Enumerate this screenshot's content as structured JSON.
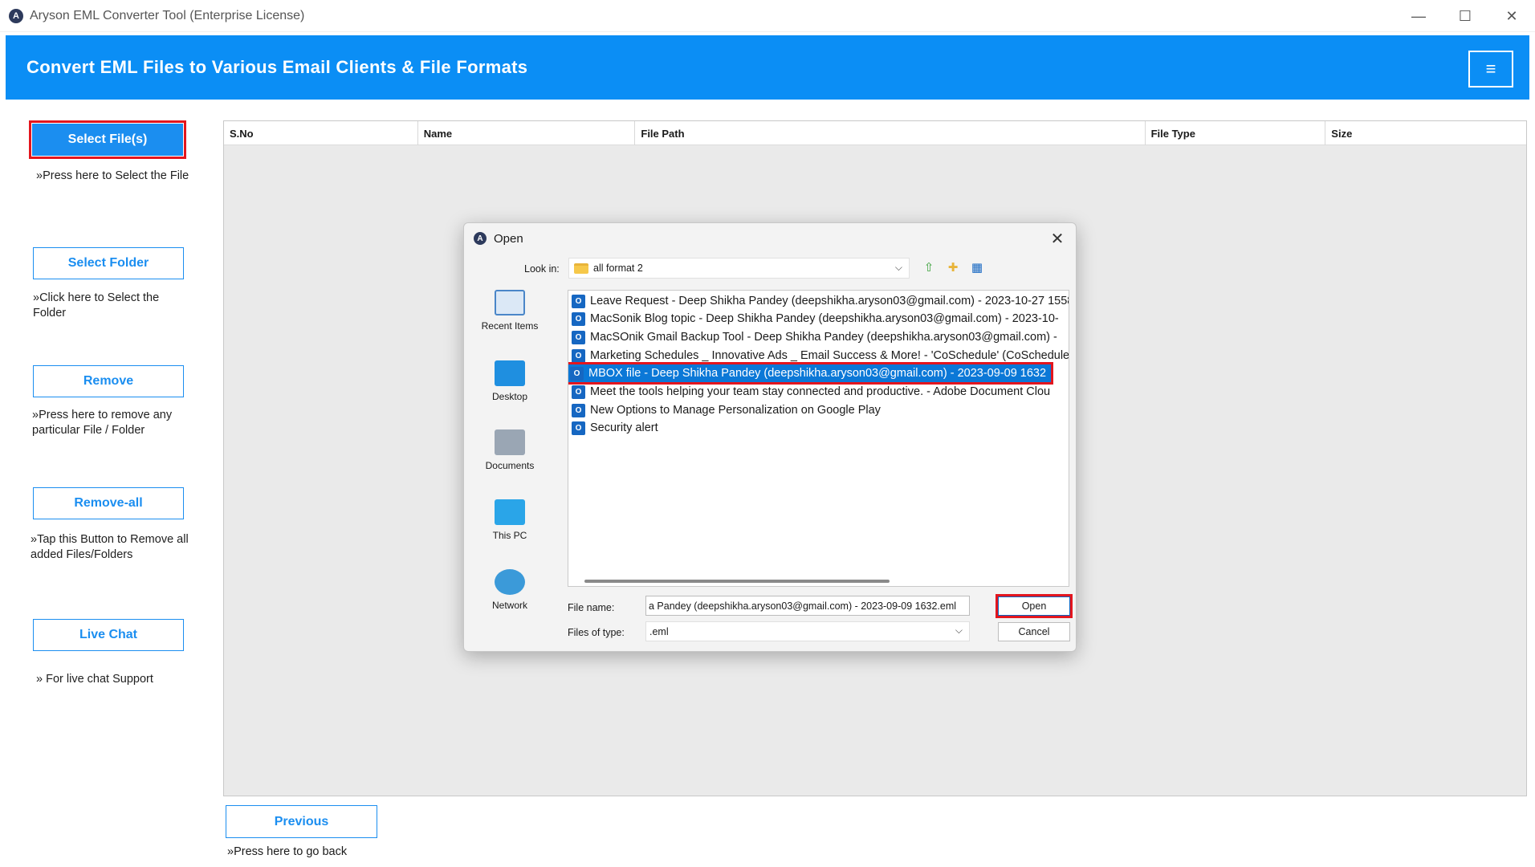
{
  "window": {
    "title": "Aryson EML Converter Tool (Enterprise License)",
    "app_icon": "aryson-logo-icon",
    "minimize": "—",
    "maximize": "☐",
    "close": "✕"
  },
  "header": {
    "title": "Convert EML Files to Various Email Clients & File Formats",
    "menu_glyph": "≡",
    "accent": "#0b8ef5"
  },
  "sidebar": {
    "select_files": {
      "label": "Select File(s)",
      "help": "»Press here to Select the File"
    },
    "select_folder": {
      "label": "Select Folder",
      "help": "»Click here to Select the Folder"
    },
    "remove": {
      "label": "Remove",
      "help": "»Press here to remove any particular File / Folder"
    },
    "remove_all": {
      "label": "Remove-all",
      "help": "»Tap this Button to Remove all added Files/Folders"
    },
    "live_chat": {
      "label": "Live Chat",
      "help": "» For live chat Support"
    }
  },
  "table": {
    "columns": [
      "S.No",
      "Name",
      "File Path",
      "File Type",
      "Size"
    ]
  },
  "dialog": {
    "title": "Open",
    "look_in_label": "Look in:",
    "look_in_value": "all format 2",
    "places": [
      "Recent Items",
      "Desktop",
      "Documents",
      "This PC",
      "Network"
    ],
    "files": [
      "Leave Request - Deep Shikha Pandey (deepshikha.aryson03@gmail.com) - 2023-10-27 1558",
      "MacSonik Blog topic - Deep Shikha Pandey (deepshikha.aryson03@gmail.com) - 2023-10-",
      "MacSOnik Gmail Backup Tool - Deep Shikha Pandey (deepshikha.aryson03@gmail.com) -",
      "Marketing Schedules _ Innovative Ads _ Email Success & More! - 'CoSchedule' (CoSchedule",
      "MBOX file - Deep Shikha Pandey (deepshikha.aryson03@gmail.com) - 2023-09-09 1632",
      "Meet the tools helping your team stay connected and productive. - Adobe Document Clou",
      "New Options to Manage Personalization on Google Play",
      "Security alert"
    ],
    "selected_index": 4,
    "file_name_label": "File name:",
    "file_name_value": "a Pandey (deepshikha.aryson03@gmail.com) - 2023-09-09 1632.eml",
    "files_of_type_label": "Files of type:",
    "files_of_type_value": ".eml",
    "open_label": "Open",
    "cancel_label": "Cancel"
  },
  "footer": {
    "previous_label": "Previous",
    "previous_help": "»Press here to go back"
  }
}
